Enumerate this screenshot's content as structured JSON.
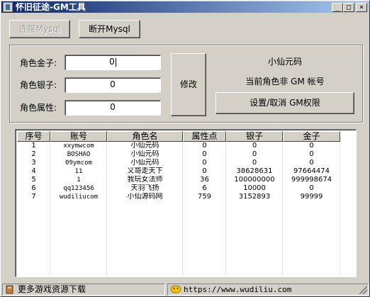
{
  "window": {
    "title": "怀旧征途-GM工具",
    "controls": {
      "minimize": "_",
      "maximize": "□",
      "close": "×"
    }
  },
  "toolbar": {
    "connect_label": "连接Mysql",
    "disconnect_label": "断开Mysql"
  },
  "form": {
    "gold_label": "角色金子:",
    "gold_value": "0",
    "silver_label": "角色银子:",
    "silver_value": "0",
    "attr_label": "角色属性:",
    "attr_value": "0",
    "modify_label": "修改"
  },
  "info": {
    "char_name": "小仙元码",
    "gm_status": "当前角色非 GM 帐号",
    "toggle_gm_label": "设置/取消 GM权限"
  },
  "table": {
    "headers": [
      "序号",
      "账号",
      "角色名",
      "属性点",
      "银子",
      "金子"
    ],
    "rows": [
      [
        "1",
        "xxymwcom",
        "小仙元码",
        "0",
        "0",
        "0"
      ],
      [
        "2",
        "BOSHAO",
        "小仙元码",
        "0",
        "0",
        "0"
      ],
      [
        "3",
        "09ymcom",
        "小仙元码",
        "0",
        "0",
        "0"
      ],
      [
        "4",
        "11",
        "义哥走天下",
        "0",
        "38628631",
        "97664474"
      ],
      [
        "5",
        "1",
        "我玩女法师",
        "36",
        "100000000",
        "999998674"
      ],
      [
        "6",
        "qq123456",
        "天羽飞扬",
        "6",
        "10000",
        "0"
      ],
      [
        "7",
        "wudiliucom",
        "小仙源码网",
        "759",
        "3152893",
        "99999"
      ]
    ]
  },
  "status": {
    "left_text": "更多游戏资源下载",
    "url_text": "https://www.wudiliu.com"
  },
  "colors": {
    "title_gradient_start": "#0a246a",
    "title_gradient_end": "#a6caf0",
    "face": "#d4d0c8"
  }
}
